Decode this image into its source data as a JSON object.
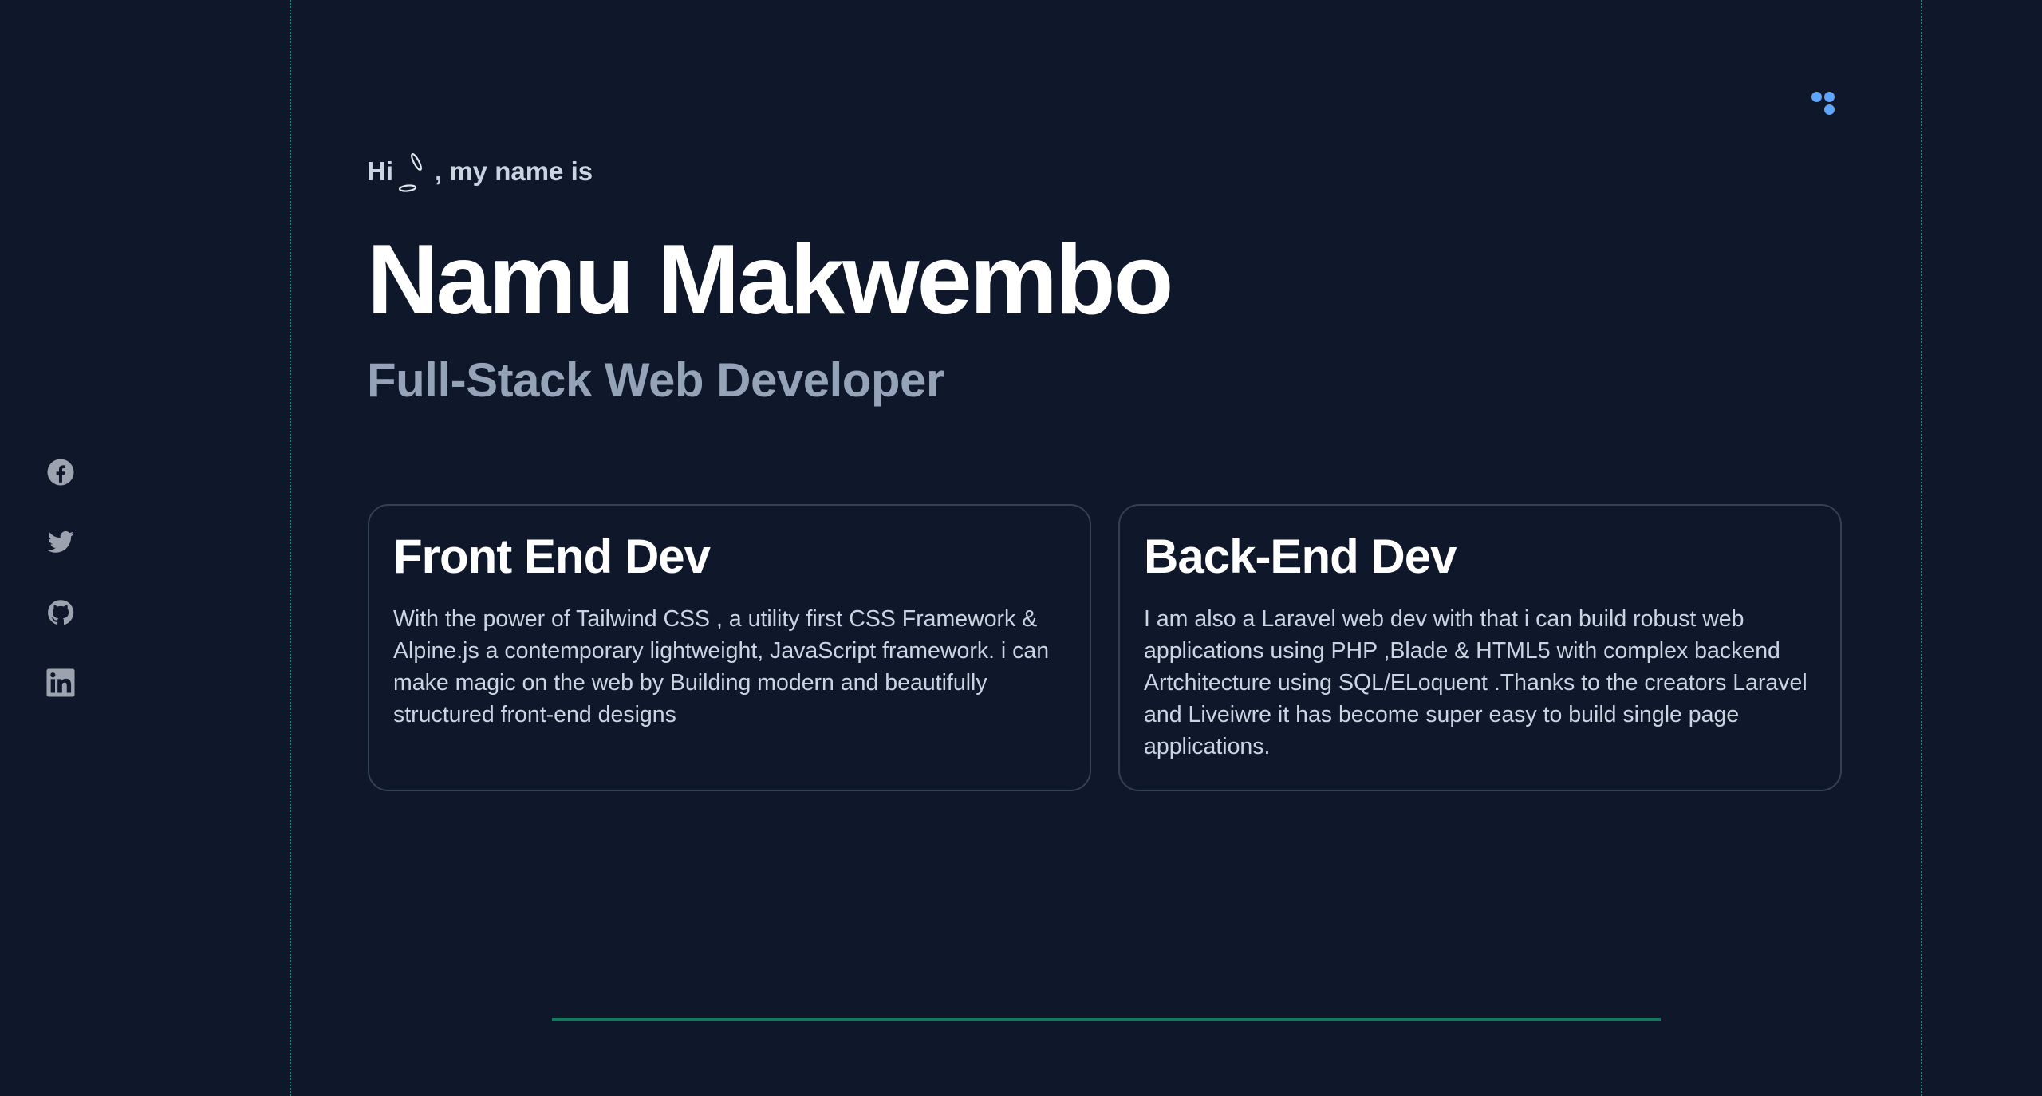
{
  "colors": {
    "background": "#0f172a",
    "guide_line": "#2dd4bf",
    "accent_blue": "#60a5fa",
    "heading": "#ffffff",
    "subtitle": "#94a3b8",
    "body_text": "#cbd5e1",
    "card_border": "#334155",
    "footer_line": "#0f7a5c",
    "icon_gray": "#9ca3af"
  },
  "social": [
    {
      "name": "facebook",
      "icon": "facebook-icon"
    },
    {
      "name": "twitter",
      "icon": "twitter-icon"
    },
    {
      "name": "github",
      "icon": "github-icon"
    },
    {
      "name": "linkedin",
      "icon": "linkedin-icon"
    }
  ],
  "menu": {
    "icon": "menu-dots-icon"
  },
  "hero": {
    "greeting_prefix": "Hi",
    "greeting_suffix": ", my name is",
    "wave_icon": "wave-icon",
    "name": "Namu Makwembo",
    "role": "Full-Stack Web Developer"
  },
  "cards": [
    {
      "title": "Front End Dev",
      "body": "With the power of Tailwind CSS , a utility first CSS Framework & Alpine.js a contemporary lightweight, JavaScript framework. i can make magic on the web by Building modern and beautifully structured front-end designs"
    },
    {
      "title": "Back-End Dev",
      "body": "I am also a Laravel web dev with that i can build robust web applications using PHP ,Blade & HTML5 with complex backend Artchitecture using SQL/ELoquent .Thanks to the creators Laravel and Liveiwre it has become super easy to build single page applications."
    }
  ]
}
